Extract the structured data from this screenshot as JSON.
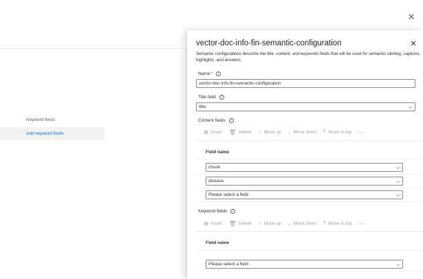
{
  "background": {
    "close_icon": "close-icon",
    "keyword_fields_label": "Keyword fields",
    "add_keyword_fields_link": "Add keyword fields"
  },
  "panel": {
    "title": "vector-doc-info-fin-semantic-configuration",
    "description": "Semantic configurations describe the title, content, and keywords fields that will be used for semantic ranking, captions, highlights, and answers.",
    "name": {
      "label": "Name",
      "required_mark": "*",
      "value": "vector-doc-info-fin-semantic-configuration"
    },
    "title_field": {
      "label": "Title field",
      "value": "title"
    },
    "content_fields": {
      "label": "Content fields",
      "toolbar": {
        "insert": "Insert",
        "delete": "Delete",
        "move_up": "Move up",
        "move_down": "Move down",
        "move_to_top": "Move to top",
        "more": "···"
      },
      "column_header": "Field name",
      "rows": [
        "chunk",
        "disease",
        "Please select a field"
      ]
    },
    "keyword_fields": {
      "label": "Keyword fields",
      "toolbar": {
        "insert": "Insert",
        "delete": "Delete",
        "move_up": "Move up",
        "move_down": "Move down",
        "move_to_top": "Move to top",
        "more": "···"
      },
      "column_header": "Field name",
      "rows": [
        "Please select a field"
      ]
    },
    "info_glyph": "i",
    "chevron_glyph": "⌵",
    "close_glyph": "✕"
  }
}
